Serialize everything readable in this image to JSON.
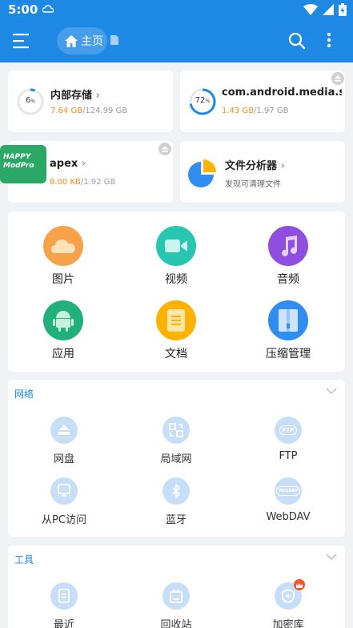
{
  "status_bar": {
    "time": "5:00"
  },
  "app_bar": {
    "breadcrumb_home": "主页"
  },
  "storage": [
    {
      "title": "内部存储",
      "used": "7.64 GB",
      "total": "/124.99 GB",
      "percent_label": "6",
      "percent_unit": "%",
      "percent": 6
    },
    {
      "title": "com.android.media.s...",
      "used": "1.43 GB",
      "total": "/1.97 GB",
      "percent_label": "72",
      "percent_unit": "%",
      "percent": 72
    },
    {
      "title": "apex",
      "used": "8.00 KB",
      "total": "/1.92 GB",
      "logo_text": "HAPPY ModPro"
    },
    {
      "title": "文件分析器",
      "subtitle": "发现可清理文件"
    }
  ],
  "categories": [
    {
      "label": "图片",
      "icon": "image-icon",
      "color": "#f7a24a"
    },
    {
      "label": "视频",
      "icon": "video-icon",
      "color": "#26c6b0"
    },
    {
      "label": "音频",
      "icon": "music-icon",
      "color": "#8e4fe0"
    },
    {
      "label": "应用",
      "icon": "android-icon",
      "color": "#22b07a"
    },
    {
      "label": "文档",
      "icon": "document-icon",
      "color": "#ffb300"
    },
    {
      "label": "压缩管理",
      "icon": "archive-icon",
      "color": "#2f8ef0"
    }
  ],
  "network": {
    "title": "网络",
    "items": [
      {
        "label": "网盘",
        "icon": "cloud-drive-icon"
      },
      {
        "label": "局域网",
        "icon": "lan-icon"
      },
      {
        "label": "FTP",
        "icon": "ftp-icon",
        "badge": "FTP"
      },
      {
        "label": "从PC访问",
        "icon": "pc-access-icon"
      },
      {
        "label": "蓝牙",
        "icon": "bluetooth-icon"
      },
      {
        "label": "WebDAV",
        "icon": "webdav-icon",
        "badge": "WebDAV"
      }
    ]
  },
  "tools": {
    "title": "工具",
    "items": [
      {
        "label": "最近",
        "icon": "recent-icon"
      },
      {
        "label": "回收站",
        "icon": "recycle-bin-icon"
      },
      {
        "label": "加密库",
        "icon": "vault-icon"
      }
    ]
  },
  "colors": {
    "primary": "#1e88e5",
    "used": "#f08c1c"
  }
}
